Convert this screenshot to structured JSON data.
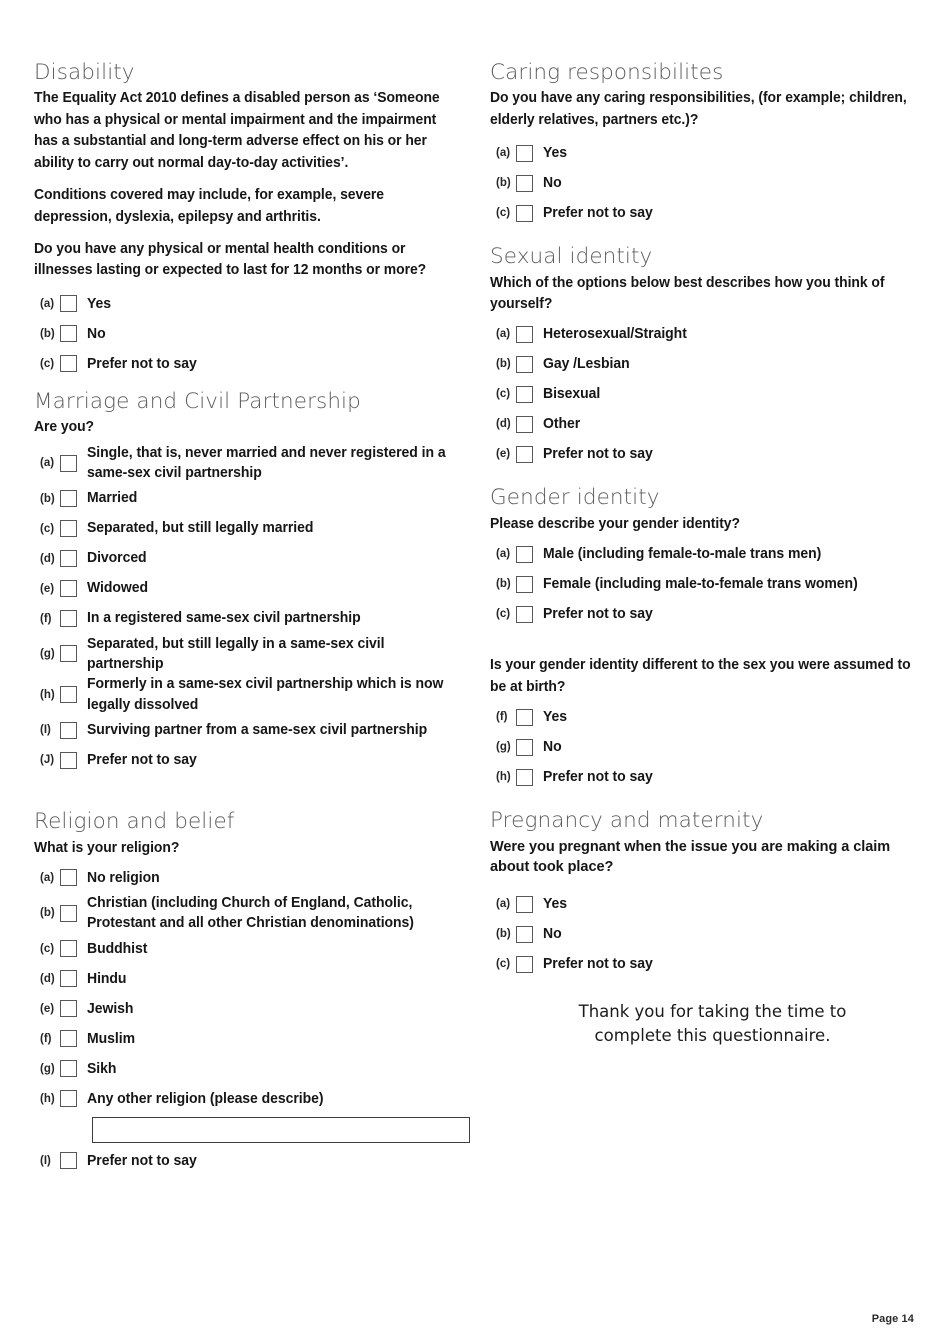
{
  "document": {
    "page_label": "Page 14",
    "closing_message_line1": "Thank you for taking the time to",
    "closing_message_line2": "complete this questionnaire."
  },
  "left_column": {
    "disability": {
      "heading": "Disability",
      "intro_paragraph": "The Equality Act 2010 defines a disabled person as ‘Someone who has a physical or mental impairment and the impairment has a substantial and long-term adverse effect on his or her ability to carry out normal day-to-day activities’.",
      "conditions_paragraph": "Conditions covered may include, for example, severe depression, dyslexia, epilepsy and arthritis.",
      "question": "Do you have any physical or mental health conditions or illnesses lasting or expected to last for 12 months or more?",
      "options": [
        {
          "letter": "(a)",
          "label": "Yes"
        },
        {
          "letter": "(b)",
          "label": "No"
        },
        {
          "letter": "(c)",
          "label": "Prefer not to say"
        }
      ]
    },
    "marriage": {
      "heading": "Marriage and Civil Partnership",
      "question": "Are you?",
      "options": [
        {
          "letter": "(a)",
          "label": "Single, that is, never married and never registered in a same-sex civil partnership",
          "two_line": true
        },
        {
          "letter": "(b)",
          "label": "Married"
        },
        {
          "letter": "(c)",
          "label": "Separated, but still legally married"
        },
        {
          "letter": "(d)",
          "label": "Divorced"
        },
        {
          "letter": "(e)",
          "label": "Widowed"
        },
        {
          "letter": "(f)",
          "label": "In a registered same-sex civil partnership"
        },
        {
          "letter": "(g)",
          "label": "Separated, but still legally in a same-sex civil partnership"
        },
        {
          "letter": "(h)",
          "label": "Formerly in a same-sex civil partnership which is now legally dissolved",
          "two_line": true
        },
        {
          "letter": "(I)",
          "label": "Surviving partner from a same-sex civil partnership"
        },
        {
          "letter": "(J)",
          "label": "Prefer not to say"
        }
      ]
    },
    "religion": {
      "heading": "Religion and belief",
      "question": "What is your religion?",
      "options": [
        {
          "letter": "(a)",
          "label": "No religion"
        },
        {
          "letter": "(b)",
          "label": "Christian (including Church of England, Catholic, Protestant and all other Christian denominations)",
          "two_line": true
        },
        {
          "letter": "(c)",
          "label": "Buddhist"
        },
        {
          "letter": "(d)",
          "label": "Hindu"
        },
        {
          "letter": "(e)",
          "label": "Jewish"
        },
        {
          "letter": "(f)",
          "label": "Muslim"
        },
        {
          "letter": "(g)",
          "label": "Sikh"
        },
        {
          "letter": "(h)",
          "label": "Any other religion (please describe)"
        }
      ],
      "other_religion_input_value": "",
      "other_religion_input_placeholder": "",
      "final_option": {
        "letter": "(I)",
        "label": "Prefer not to say"
      }
    }
  },
  "right_column": {
    "caring": {
      "heading": "Caring responsibilites",
      "question": "Do you have any caring responsibilities, (for example; children, elderly relatives, partners etc.)?",
      "options": [
        {
          "letter": "(a)",
          "label": "Yes"
        },
        {
          "letter": "(b)",
          "label": "No"
        },
        {
          "letter": "(c)",
          "label": "Prefer not to say"
        }
      ]
    },
    "sexual_identity": {
      "heading": "Sexual identity",
      "question": "Which of the options below best describes how you think of yourself?",
      "options": [
        {
          "letter": "(a)",
          "label": "Heterosexual/Straight"
        },
        {
          "letter": "(b)",
          "label": "Gay /Lesbian"
        },
        {
          "letter": "(c)",
          "label": "Bisexual"
        },
        {
          "letter": "(d)",
          "label": "Other"
        },
        {
          "letter": "(e)",
          "label": "Prefer not to say"
        }
      ]
    },
    "gender_identity": {
      "heading": "Gender identity",
      "question": "Please describe your gender identity?",
      "options": [
        {
          "letter": "(a)",
          "label": "Male (including female-to-male trans men)"
        },
        {
          "letter": "(b)",
          "label": "Female (including male-to-female trans women)"
        },
        {
          "letter": "(c)",
          "label": "Prefer not to say"
        }
      ],
      "second_question": "Is your gender identity different to the sex you were assumed to be at birth?",
      "second_options": [
        {
          "letter": "(f)",
          "label": "Yes"
        },
        {
          "letter": "(g)",
          "label": "No"
        },
        {
          "letter": "(h)",
          "label": "Prefer not to say"
        }
      ]
    },
    "pregnancy": {
      "heading": "Pregnancy and maternity",
      "question": "Were you pregnant when the issue you are making a claim about took place?",
      "options": [
        {
          "letter": "(a)",
          "label": "Yes"
        },
        {
          "letter": "(b)",
          "label": "No"
        },
        {
          "letter": "(c)",
          "label": "Prefer not to say"
        }
      ]
    }
  }
}
